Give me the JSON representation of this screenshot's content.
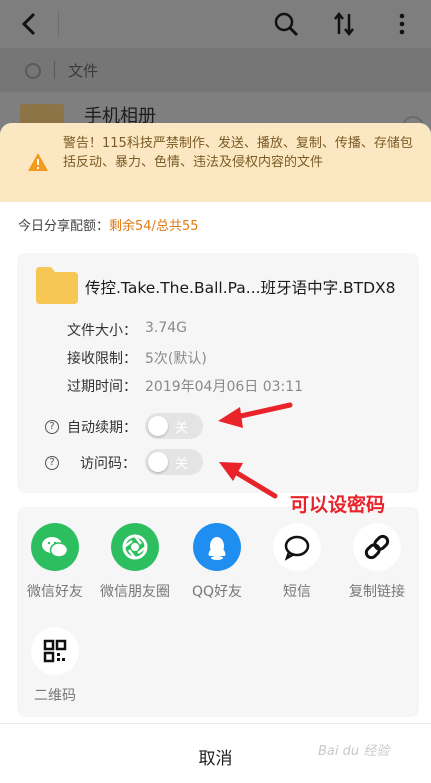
{
  "background": {
    "breadcrumb": "文件",
    "folder_name": "手机相册"
  },
  "warning": {
    "text": "警告！115科技严禁制作、发送、播放、复制、传播、存储包括反动、暴力、色情、违法及侵权内容的文件"
  },
  "quota": {
    "label": "今日分享配额：",
    "value": "剩余54/总共55"
  },
  "file": {
    "name": "传控.Take.The.Ball.Pa...班牙语中字.BTDX8",
    "details": [
      {
        "label": "文件大小：",
        "value": "3.74G"
      },
      {
        "label": "接收限制：",
        "value": "5次(默认)"
      },
      {
        "label": "过期时间：",
        "value": "2019年04月06日 03:11"
      }
    ],
    "settings": [
      {
        "label": "自动续期：",
        "state": "关"
      },
      {
        "label": "访问码：",
        "state": "关"
      }
    ]
  },
  "share": {
    "items": [
      {
        "label": "微信好友",
        "icon": "wechat-icon",
        "color": "#2dbe60"
      },
      {
        "label": "微信朋友圈",
        "icon": "moments-icon",
        "color": "#2dbe60"
      },
      {
        "label": "QQ好友",
        "icon": "qq-icon",
        "color": "#1e8ef0"
      },
      {
        "label": "短信",
        "icon": "message-icon",
        "color": "#ffffff"
      },
      {
        "label": "复制链接",
        "icon": "link-icon",
        "color": "#ffffff"
      },
      {
        "label": "二维码",
        "icon": "qrcode-icon",
        "color": "#ffffff"
      }
    ]
  },
  "cancel_label": "取消",
  "annotation": "可以设密码",
  "watermark": "Bai du 经验"
}
